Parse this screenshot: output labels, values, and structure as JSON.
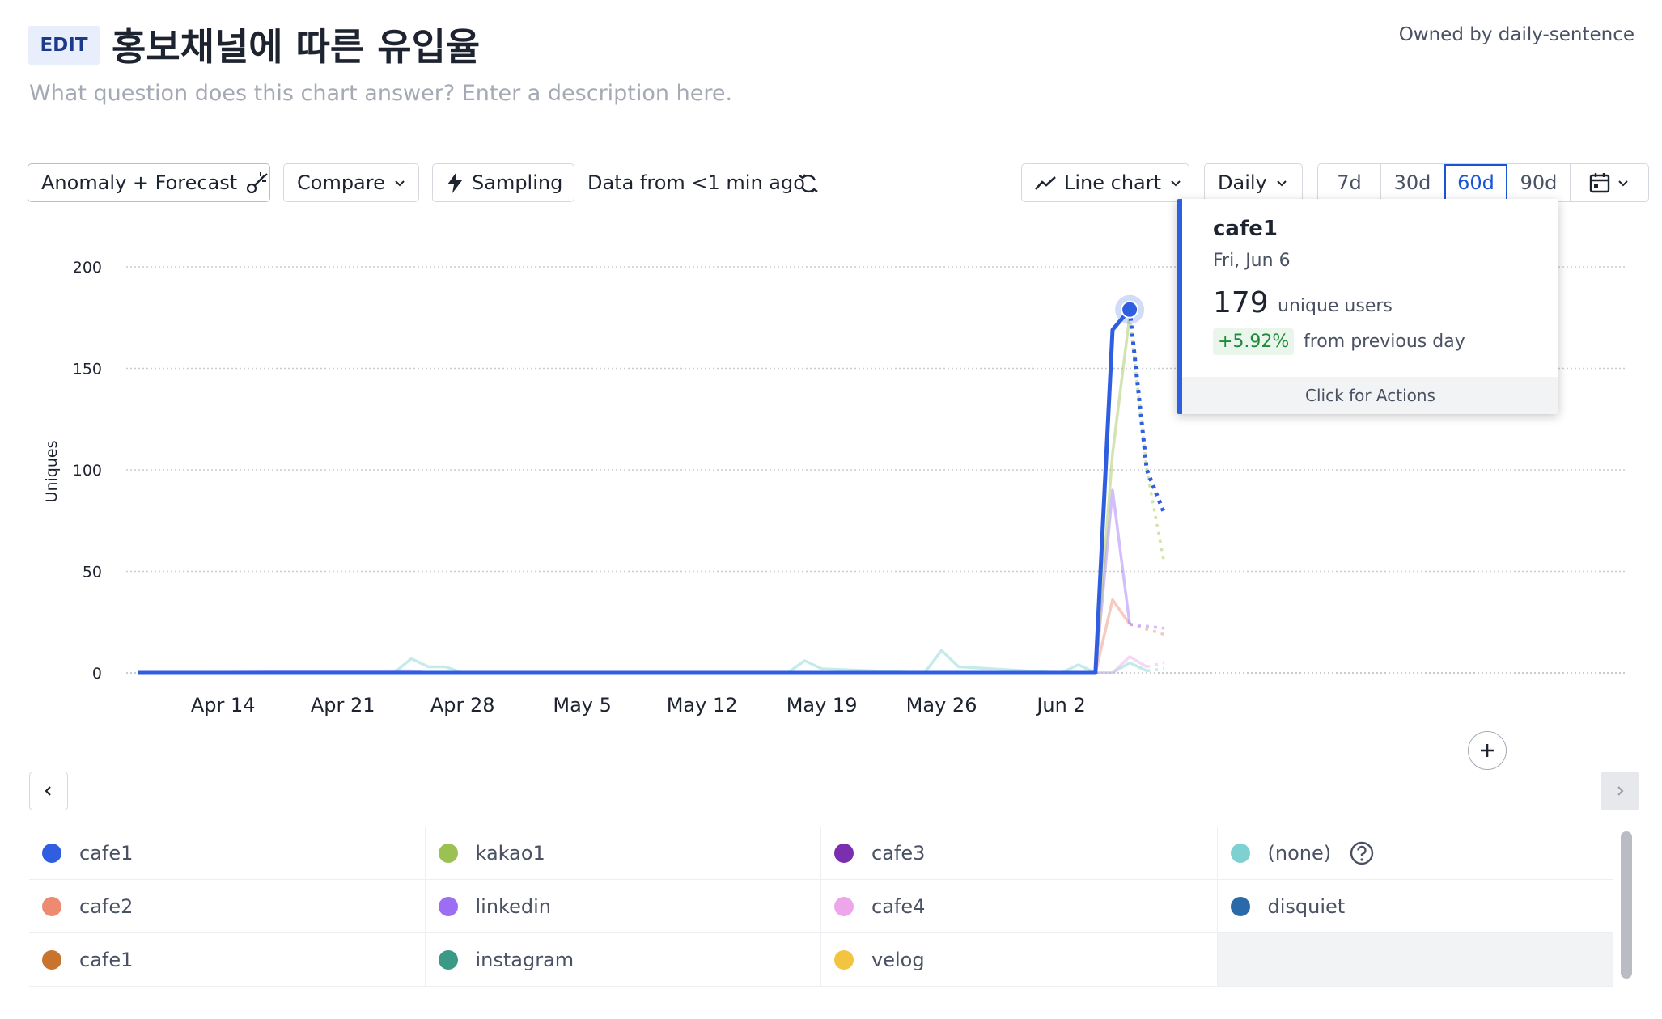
{
  "header": {
    "edit_label": "EDIT",
    "title": "홍보채널에 따른 유입율",
    "owner": "Owned by daily-sentence",
    "description_placeholder": "What question does this chart answer? Enter a description here."
  },
  "toolbar": {
    "anomaly_label": "Anomaly + Forecast",
    "compare_label": "Compare",
    "sampling_label": "Sampling",
    "data_age": "Data from <1 min ago",
    "chart_type_label": "Line chart",
    "interval_label": "Daily",
    "ranges": [
      "7d",
      "30d",
      "60d",
      "90d"
    ],
    "active_range": "60d"
  },
  "tooltip": {
    "series": "cafe1",
    "date": "Fri, Jun 6",
    "value": "179",
    "unit": "unique users",
    "change": "+5.92%",
    "change_text": "from previous day",
    "actions": "Click for Actions"
  },
  "colors": {
    "cafe1": "#2f5ee0",
    "kakao1": "#9cc153",
    "cafe3": "#7b2fb0",
    "none": "#7fd1d1",
    "cafe2": "#ec8a72",
    "linkedin": "#9b6ef3",
    "cafe4": "#eda6ea",
    "disquiet": "#2b6aa8",
    "cafe1_alt": "#c8732e",
    "instagram": "#3b9a86",
    "velog": "#f2c440"
  },
  "legend": [
    {
      "label": "cafe1",
      "color": "#2f5ee0"
    },
    {
      "label": "kakao1",
      "color": "#9cc153"
    },
    {
      "label": "cafe3",
      "color": "#7b2fb0"
    },
    {
      "label": "(none)",
      "color": "#7fd1d1",
      "help": true
    },
    {
      "label": "cafe2",
      "color": "#ec8a72"
    },
    {
      "label": "linkedin",
      "color": "#9b6ef3"
    },
    {
      "label": "cafe4",
      "color": "#eda6ea"
    },
    {
      "label": "disquiet",
      "color": "#2b6aa8"
    },
    {
      "label": "cafe1",
      "color": "#c8732e"
    },
    {
      "label": "instagram",
      "color": "#3b9a86"
    },
    {
      "label": "velog",
      "color": "#f2c440"
    }
  ],
  "chart_data": {
    "type": "line",
    "ylabel": "Uniques",
    "ylim": [
      0,
      200
    ],
    "yticks": [
      0,
      50,
      100,
      150,
      200
    ],
    "xlim": [
      "2025-04-09",
      "2025-06-07"
    ],
    "xticks": [
      {
        "date": "2025-04-14",
        "label": "Apr 14"
      },
      {
        "date": "2025-04-21",
        "label": "Apr 21"
      },
      {
        "date": "2025-04-28",
        "label": "Apr 28"
      },
      {
        "date": "2025-05-05",
        "label": "May 5"
      },
      {
        "date": "2025-05-12",
        "label": "May 12"
      },
      {
        "date": "2025-05-19",
        "label": "May 19"
      },
      {
        "date": "2025-05-26",
        "label": "May 26"
      },
      {
        "date": "2025-06-02",
        "label": "Jun 2"
      }
    ],
    "grid": true,
    "series": [
      {
        "name": "(none)",
        "color": "#7fd1d1",
        "points": [
          [
            "2025-04-09",
            0
          ],
          [
            "2025-04-24",
            0
          ],
          [
            "2025-04-25",
            7
          ],
          [
            "2025-04-26",
            3
          ],
          [
            "2025-04-27",
            3
          ],
          [
            "2025-04-28",
            0
          ],
          [
            "2025-05-17",
            0
          ],
          [
            "2025-05-18",
            6
          ],
          [
            "2025-05-19",
            2
          ],
          [
            "2025-05-25",
            0
          ],
          [
            "2025-05-26",
            11
          ],
          [
            "2025-05-27",
            3
          ],
          [
            "2025-06-02",
            0
          ],
          [
            "2025-06-03",
            4
          ],
          [
            "2025-06-04",
            0
          ],
          [
            "2025-06-05",
            0
          ],
          [
            "2025-06-06",
            5
          ],
          [
            "2025-06-07",
            1
          ]
        ],
        "forecast": [
          [
            "2025-06-07",
            1
          ],
          [
            "2025-06-08",
            2
          ]
        ]
      },
      {
        "name": "cafe2",
        "color": "#ec8a72",
        "points": [
          [
            "2025-04-09",
            0
          ],
          [
            "2025-06-04",
            0
          ],
          [
            "2025-06-05",
            36
          ],
          [
            "2025-06-06",
            24
          ]
        ],
        "forecast": [
          [
            "2025-06-06",
            24
          ],
          [
            "2025-06-08",
            19
          ]
        ]
      },
      {
        "name": "cafe4",
        "color": "#eda6ea",
        "points": [
          [
            "2025-04-09",
            0
          ],
          [
            "2025-06-05",
            0
          ],
          [
            "2025-06-06",
            8
          ],
          [
            "2025-06-07",
            3
          ]
        ],
        "forecast": [
          [
            "2025-06-07",
            3
          ],
          [
            "2025-06-08",
            5
          ]
        ]
      },
      {
        "name": "linkedin",
        "color": "#9b6ef3",
        "points": [
          [
            "2025-04-09",
            0
          ],
          [
            "2025-04-25",
            1
          ],
          [
            "2025-04-26",
            0
          ],
          [
            "2025-06-04",
            0
          ],
          [
            "2025-06-05",
            90
          ],
          [
            "2025-06-06",
            24
          ]
        ],
        "forecast": [
          [
            "2025-06-06",
            24
          ],
          [
            "2025-06-08",
            22
          ]
        ]
      },
      {
        "name": "kakao1",
        "color": "#9cc153",
        "points": [
          [
            "2025-04-09",
            0
          ],
          [
            "2025-06-04",
            0
          ],
          [
            "2025-06-05",
            108
          ],
          [
            "2025-06-06",
            176
          ]
        ],
        "forecast": [
          [
            "2025-06-06",
            176
          ],
          [
            "2025-06-07",
            100
          ],
          [
            "2025-06-08",
            55
          ]
        ]
      },
      {
        "name": "cafe1",
        "color": "#2f5ee0",
        "points": [
          [
            "2025-04-09",
            0
          ],
          [
            "2025-06-04",
            0
          ],
          [
            "2025-06-05",
            169
          ],
          [
            "2025-06-06",
            179
          ]
        ],
        "forecast": [
          [
            "2025-06-06",
            179
          ],
          [
            "2025-06-07",
            100
          ],
          [
            "2025-06-08",
            79
          ]
        ]
      }
    ],
    "highlight": {
      "series": "cafe1",
      "x": "2025-06-06",
      "y": 179
    }
  }
}
